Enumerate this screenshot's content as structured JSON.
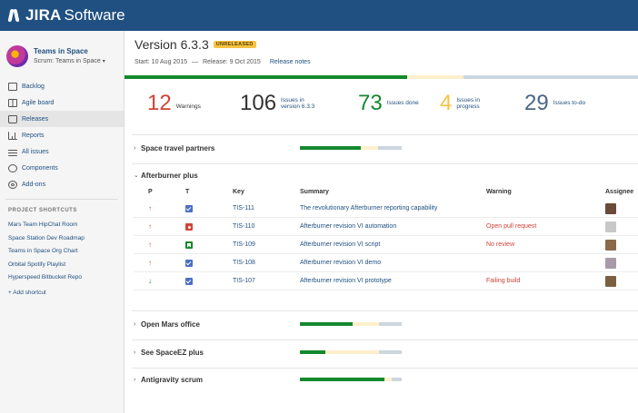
{
  "app": {
    "brand": "JIRA",
    "product": "Software"
  },
  "sidebar": {
    "project_name": "Teams in Space",
    "board_name": "Scrum: Teams in Space",
    "nav": [
      {
        "label": "Backlog",
        "icon": "backlog-icon"
      },
      {
        "label": "Agile board",
        "icon": "board-icon"
      },
      {
        "label": "Releases",
        "icon": "releases-icon",
        "active": true
      },
      {
        "label": "Reports",
        "icon": "reports-icon"
      },
      {
        "label": "All issues",
        "icon": "issues-icon"
      },
      {
        "label": "Components",
        "icon": "components-icon"
      },
      {
        "label": "Add-ons",
        "icon": "addons-icon"
      }
    ],
    "shortcuts_title": "PROJECT SHORTCUTS",
    "shortcuts": [
      "Mars Team HipChat Room",
      "Space Station Dev Roadmap",
      "Teams in Space Org Chart",
      "Orbital Spotify Playlist",
      "Hyperspeed Bitbucket Repo"
    ],
    "add_shortcut": "+ Add shortcut"
  },
  "version": {
    "title": "Version 6.3.3",
    "status": "UNRELEASED",
    "start": "Start: 10 Aug 2015",
    "separator": "—",
    "release": "Release: 9 Oct 2015",
    "notes_link": "Release notes",
    "progress": {
      "done": 0.55,
      "in_progress": 0.11,
      "todo": 0.34
    }
  },
  "stats": [
    {
      "value": "12",
      "label": "Warnings",
      "color": "#d04437"
    },
    {
      "value": "106",
      "label": "Issues in version 6.3.3",
      "color": "#333333"
    },
    {
      "value": "73",
      "label": "Issues done",
      "color": "#14892c"
    },
    {
      "value": "4",
      "label": "Issues in progress",
      "color": "#f6c342"
    },
    {
      "value": "29",
      "label": "Issues to-do",
      "color": "#4a6785"
    }
  ],
  "epics": [
    {
      "name": "Space travel partners",
      "expanded": false,
      "progress": {
        "done": 0.6,
        "in_progress": 0.17,
        "todo": 0.23
      }
    },
    {
      "name": "Afterburner plus",
      "expanded": true
    },
    {
      "name": "Open Mars office",
      "expanded": false,
      "progress": {
        "done": 0.52,
        "in_progress": 0.26,
        "todo": 0.22
      }
    },
    {
      "name": "See SpaceEZ plus",
      "expanded": false,
      "progress": {
        "done": 0.25,
        "in_progress": 0.53,
        "todo": 0.22
      }
    },
    {
      "name": "Antigravity scrum",
      "expanded": false,
      "progress": {
        "done": 0.83,
        "in_progress": 0.07,
        "todo": 0.1
      }
    }
  ],
  "table": {
    "headers": {
      "p": "P",
      "t": "T",
      "key": "Key",
      "summary": "Summary",
      "warning": "Warning",
      "assignee": "Assignee"
    },
    "rows": [
      {
        "priority": "up",
        "type": "task",
        "key": "TIS-111",
        "summary": "The revolutionary Afterburner reporting capability",
        "warning": "",
        "assignee_color": "#6b4a3a"
      },
      {
        "priority": "up",
        "type": "bug",
        "key": "TIS-110",
        "summary": "Afterburner revision VI automation",
        "warning": "Open pull request",
        "assignee_color": "#c8c8c8"
      },
      {
        "priority": "up",
        "type": "story",
        "key": "TIS-109",
        "summary": "Afterburner revision VI script",
        "warning": "No review",
        "assignee_color": "#8a6a4a"
      },
      {
        "priority": "up",
        "type": "task",
        "key": "TIS-108",
        "summary": "Afterburner revision VI demo",
        "warning": "",
        "assignee_color": "#a89aa8"
      },
      {
        "priority": "down",
        "type": "task",
        "key": "TIS-107",
        "summary": "Afterburner revision VI prototype",
        "warning": "Failing build",
        "assignee_color": "#7a6040"
      }
    ]
  },
  "colors": {
    "topbar": "#205081",
    "done": "#14892c",
    "in_progress": "#fbe3a0",
    "todo": "#ccd6df"
  }
}
